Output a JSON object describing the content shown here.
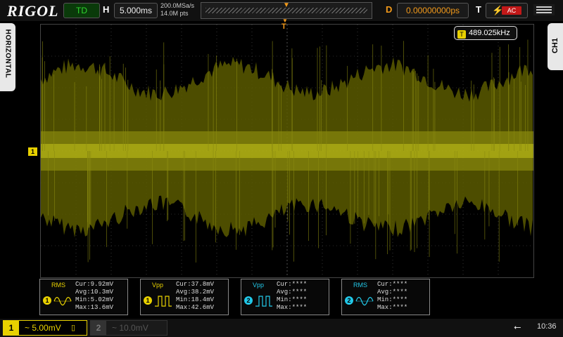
{
  "header": {
    "brand": "RIGOL",
    "run_state": "TD",
    "horizontal_key": "H",
    "timebase": "5.000ms",
    "sample_rate": "200.0MSa/s",
    "memory_depth": "14.0M pts",
    "delay_key": "D",
    "delay_value": "0.00000000ps",
    "trigger_key": "T",
    "trigger_source": "AC"
  },
  "side_tabs": {
    "left": "HORIZONTAL",
    "right": "CH1"
  },
  "counter": {
    "badge": "T",
    "frequency": "489.025kHz"
  },
  "markers": {
    "trigger_position": "T",
    "ch1_level": "1"
  },
  "measurements": [
    {
      "name": "RMS",
      "channel": "1",
      "color": "#e8d100",
      "cur": "Cur:9.92mV",
      "avg": "Avg:10.3mV",
      "min": "Min:5.02mV",
      "max": "Max:13.6mV"
    },
    {
      "name": "Vpp",
      "channel": "1",
      "color": "#e8d100",
      "cur": "Cur:37.8mV",
      "avg": "Avg:38.2mV",
      "min": "Min:18.4mV",
      "max": "Max:42.6mV"
    },
    {
      "name": "Vpp",
      "channel": "2",
      "color": "#22c8e8",
      "cur": "Cur:****",
      "avg": "Avg:****",
      "min": "Min:****",
      "max": "Max:****"
    },
    {
      "name": "RMS",
      "channel": "2",
      "color": "#22c8e8",
      "cur": "Cur:****",
      "avg": "Avg:****",
      "min": "Min:****",
      "max": "Max:****"
    }
  ],
  "channels": {
    "ch1": {
      "number": "1",
      "scale": "~ 5.00mV",
      "color": "#e8d100"
    },
    "ch2": {
      "number": "2",
      "scale": "~ 10.0mV",
      "color": "#555555"
    }
  },
  "status": {
    "time": "10:36"
  }
}
